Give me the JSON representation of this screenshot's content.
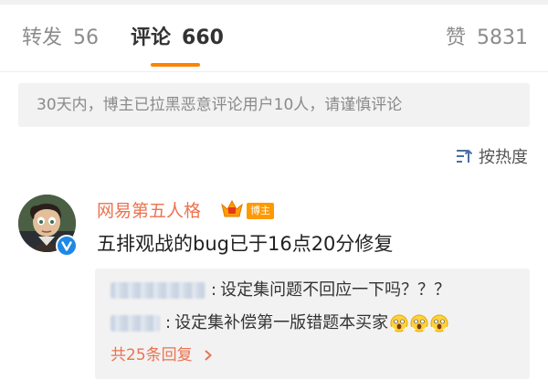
{
  "tabs": {
    "repost": {
      "label": "转发",
      "count": "56"
    },
    "comment": {
      "label": "评论",
      "count": "660"
    },
    "like": {
      "label": "赞",
      "count": "5831"
    }
  },
  "notice": "30天内，博主已拉黑恶意评论用户10人，请谨慎评论",
  "sort": {
    "label": "按热度",
    "icon": "sort-icon"
  },
  "comment": {
    "username": "网易第五人格",
    "badge": "博主",
    "text": "五排观战的bug已于16点20分修复",
    "replies": [
      {
        "name_redacted": true,
        "sep": ":",
        "text": "设定集问题不回应一下吗？？？"
      },
      {
        "name_redacted": true,
        "sep": ":",
        "text": "设定集补偿第一版错题本买家"
      }
    ],
    "more": "共25条回复"
  },
  "colors": {
    "accent": "#ff8200",
    "username": "#eb7350",
    "muted": "#8c8c8c",
    "panel": "#f2f2f2"
  }
}
